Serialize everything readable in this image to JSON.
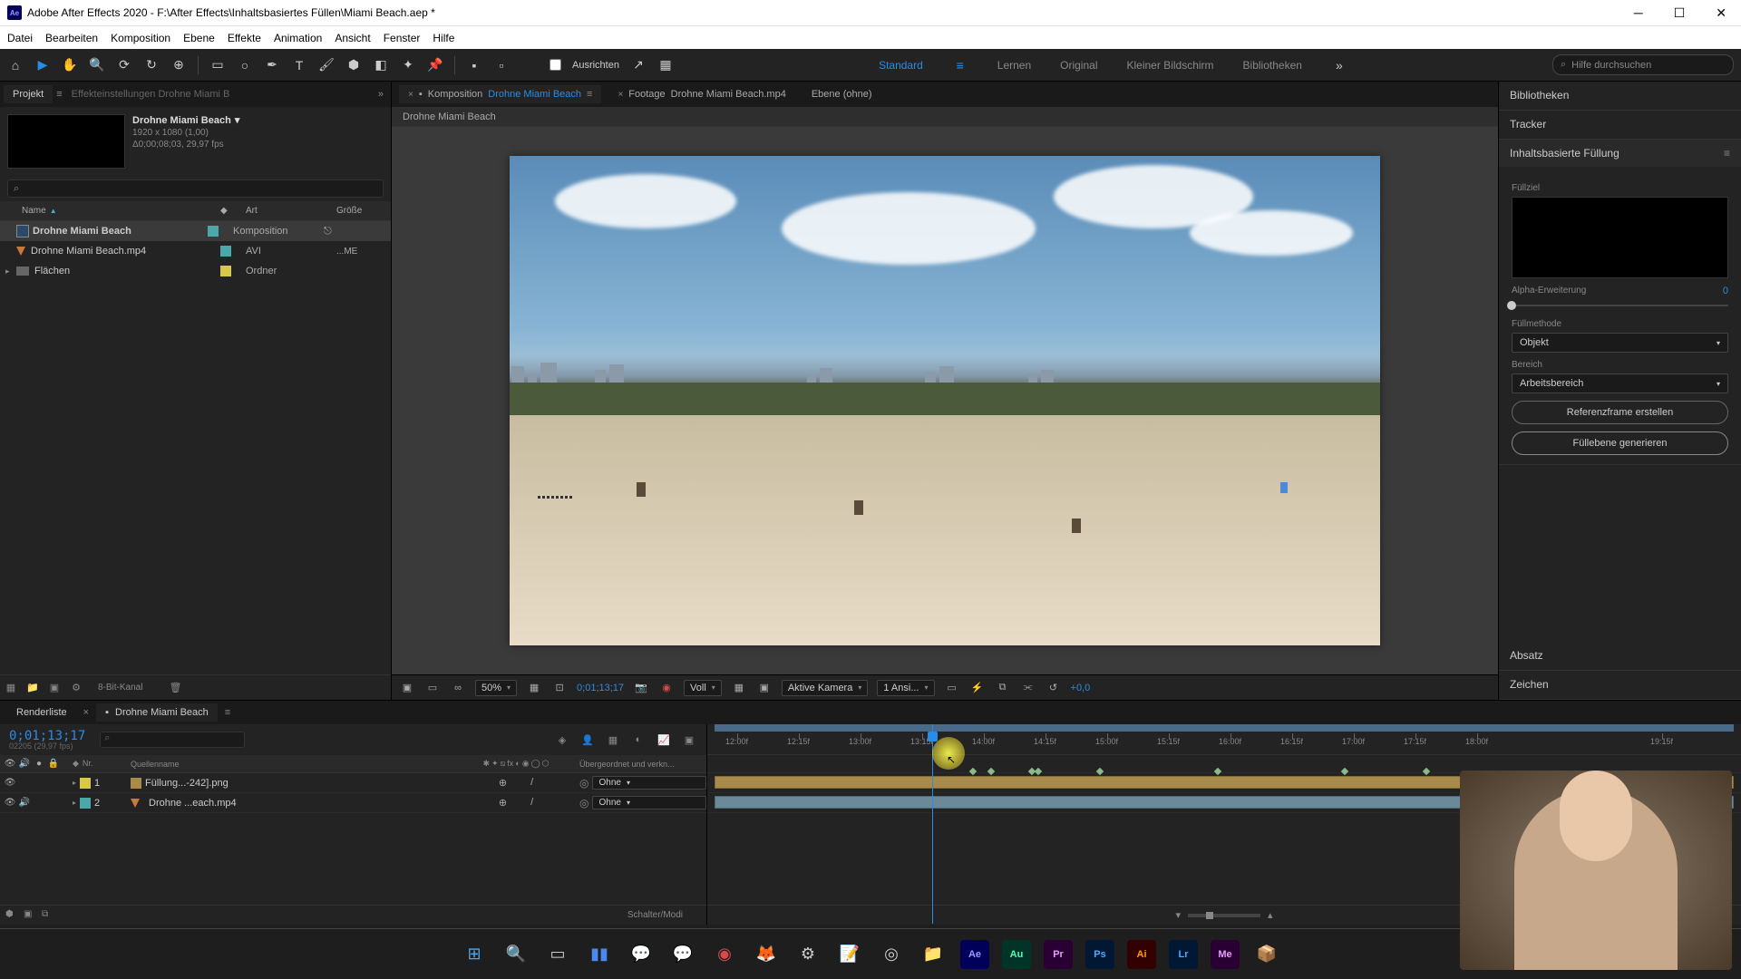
{
  "titlebar": {
    "app_icon": "Ae",
    "title": "Adobe After Effects 2020 - F:\\After Effects\\Inhaltsbasiertes Füllen\\Miami Beach.aep *"
  },
  "menu": {
    "items": [
      "Datei",
      "Bearbeiten",
      "Komposition",
      "Ebene",
      "Effekte",
      "Animation",
      "Ansicht",
      "Fenster",
      "Hilfe"
    ]
  },
  "toolbar": {
    "ausrichten": "Ausrichten",
    "workspaces": {
      "standard": "Standard",
      "lernen": "Lernen",
      "original": "Original",
      "kleiner": "Kleiner Bildschirm",
      "biblio": "Bibliotheken"
    },
    "search_placeholder": "Hilfe durchsuchen"
  },
  "project_panel": {
    "tab_project": "Projekt",
    "tab_effect": "Effekteinstellungen Drohne Miami B",
    "composition_name": "Drohne Miami Beach",
    "resolution": "1920 x 1080 (1,00)",
    "duration": "Δ0;00;08;03, 29,97 fps",
    "col_name": "Name",
    "col_art": "Art",
    "col_size": "Größe",
    "rows": [
      {
        "name": "Drohne Miami Beach",
        "type": "Komposition",
        "size": ""
      },
      {
        "name": "Drohne Miami Beach.mp4",
        "type": "AVI",
        "size": "...ME"
      },
      {
        "name": "Flächen",
        "type": "Ordner",
        "size": ""
      }
    ],
    "footer_label": "8-Bit-Kanal"
  },
  "viewer": {
    "tab_comp_prefix": "Komposition",
    "tab_comp_name": "Drohne Miami Beach",
    "tab_footage_prefix": "Footage",
    "tab_footage_name": "Drohne Miami Beach.mp4",
    "tab_layer": "Ebene  (ohne)",
    "crumb": "Drohne Miami Beach",
    "zoom": "50%",
    "timecode": "0;01;13;17",
    "resolution": "Voll",
    "camera": "Aktive Kamera",
    "views": "1 Ansi...",
    "exposure": "+0,0"
  },
  "right_panel": {
    "bibliotheken": "Bibliotheken",
    "tracker": "Tracker",
    "caf_title": "Inhaltsbasierte Füllung",
    "fill_target": "Füllziel",
    "alpha_exp": "Alpha-Erweiterung",
    "alpha_value": "0",
    "fill_method": "Füllmethode",
    "fill_method_value": "Objekt",
    "range": "Bereich",
    "range_value": "Arbeitsbereich",
    "ref_frame_btn": "Referenzframe erstellen",
    "generate_btn": "Füllebene generieren",
    "absatz": "Absatz",
    "zeichen": "Zeichen"
  },
  "timeline": {
    "tab_render": "Renderliste",
    "tab_comp": "Drohne Miami Beach",
    "timecode": "0;01;13;17",
    "sub_timecode": "02205 (29,97 fps)",
    "col_nr": "Nr.",
    "col_source": "Quellenname",
    "col_parent": "Übergeordnet und verkn...",
    "layers": [
      {
        "nr": "1",
        "name": "Füllung...-242].png",
        "parent": "Ohne"
      },
      {
        "nr": "2",
        "name": "Drohne ...each.mp4",
        "parent": "Ohne"
      }
    ],
    "ticks": [
      "12:00f",
      "12:15f",
      "13:00f",
      "13:15f",
      "14:00f",
      "14:15f",
      "15:00f",
      "15:15f",
      "16:00f",
      "16:15f",
      "17:00f",
      "17:15f",
      "18:00f",
      "19:15f"
    ],
    "footer_switch": "Schalter/Modi"
  }
}
